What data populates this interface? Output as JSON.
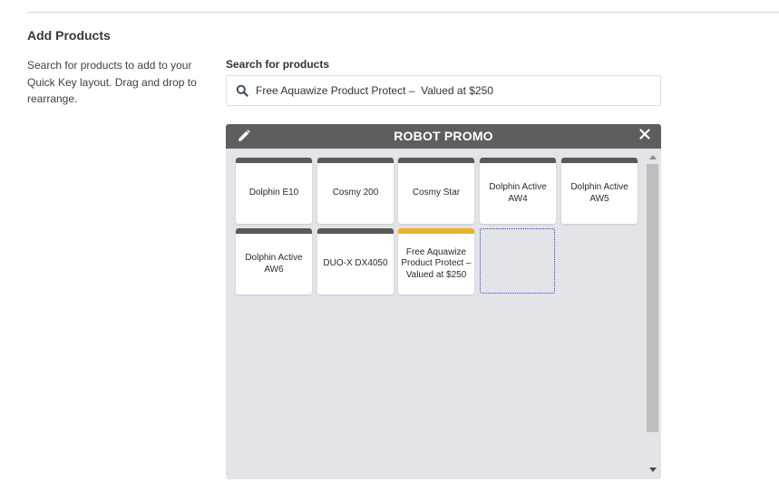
{
  "section": {
    "title": "Add Products",
    "description": "Search for products to add to your Quick Key layout. Drag and drop to rearrange."
  },
  "search": {
    "label": "Search for products",
    "value": "Free Aquawize Product Protect –  Valued at $250",
    "icon": "search-icon"
  },
  "panel": {
    "title": "ROBOT PROMO",
    "edit_icon": "pencil-icon",
    "close_icon": "close-icon",
    "tiles": [
      {
        "label": "Dolphin E10",
        "color": "#595959"
      },
      {
        "label": "Cosmy 200",
        "color": "#595959"
      },
      {
        "label": "Cosmy Star",
        "color": "#595959"
      },
      {
        "label": "Dolphin Active AW4",
        "color": "#595959"
      },
      {
        "label": "Dolphin Active AW5",
        "color": "#595959"
      },
      {
        "label": "Dolphin Active AW6",
        "color": "#595959"
      },
      {
        "label": "DUO-X DX4050",
        "color": "#595959"
      },
      {
        "label": "Free Aquawize Product Protect – Valued at $250",
        "color": "#e8b22c"
      }
    ]
  }
}
